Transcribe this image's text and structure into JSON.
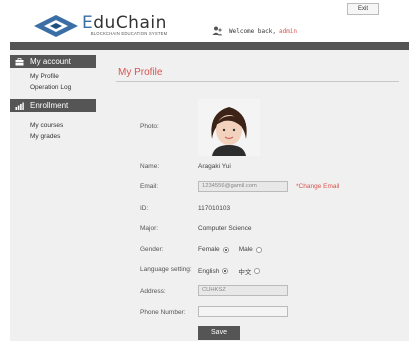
{
  "header": {
    "logo_prefix": "E",
    "logo_rest": "duChain",
    "logo_sub": "BLOCKCHAIN EDUCATION SYSTEM",
    "welcome_text": "Welcome back,",
    "username": "admin",
    "exit_label": "Exit"
  },
  "sidebar": {
    "account_title": "My account",
    "account_items": [
      "My Profile",
      "Operation Log"
    ],
    "enrollment_title": "Enrollment",
    "enrollment_items": [
      "My courses",
      "My grades"
    ]
  },
  "profile": {
    "title": "My Profile",
    "photo_label": "Photo:",
    "name_label": "Name:",
    "name_value": "Aragaki Yui",
    "email_label": "Email:",
    "email_value": "1234556@gamil.com",
    "change_email": "*Change Email",
    "id_label": "ID:",
    "id_value": "117010103",
    "major_label": "Major:",
    "major_value": "Computer Science",
    "gender_label": "Gender:",
    "gender_options": [
      "Female",
      "Male"
    ],
    "gender_selected": "Female",
    "language_label": "Language setting:",
    "language_options": [
      "English",
      "中文"
    ],
    "language_selected": "English",
    "address_label": "Address:",
    "address_value": "CUHKSZ",
    "phone_label": "Phone Number:",
    "phone_value": "",
    "save_label": "Save"
  },
  "colors": {
    "accent": "#d9534f",
    "dark_bar": "#555555",
    "panel_bg": "#f0f0f0"
  }
}
